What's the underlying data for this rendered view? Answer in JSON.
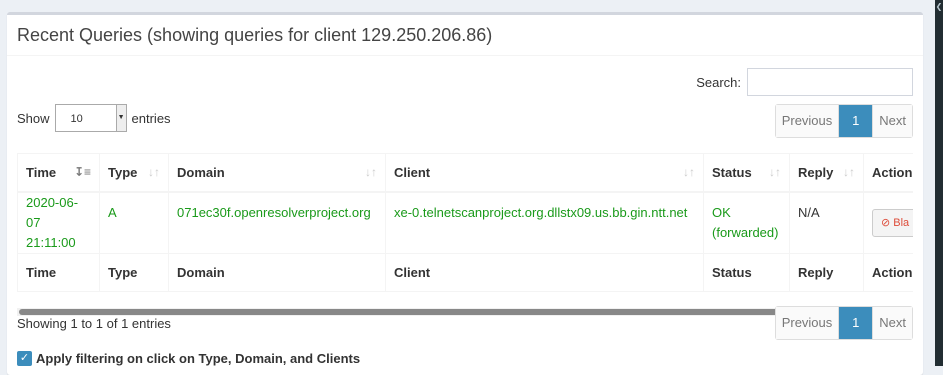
{
  "header": {
    "title": "Recent Queries (showing queries for client 129.250.206.86)"
  },
  "search": {
    "label": "Search:",
    "value": ""
  },
  "length": {
    "show_label": "Show",
    "value": "10",
    "entries_label": "entries"
  },
  "pagination": {
    "previous": "Previous",
    "current_page": "1",
    "next": "Next"
  },
  "table": {
    "columns": [
      "Time",
      "Type",
      "Domain",
      "Client",
      "Status",
      "Reply",
      "Action"
    ],
    "rows": [
      {
        "time_date": "2020-06-07",
        "time_clock": "21:11:00",
        "type": "A",
        "domain": "071ec30f.openresolverproject.org",
        "client": "xe-0.telnetscanproject.org.dllstx09.us.bb.gin.ntt.net",
        "status_main": "OK",
        "status_sub": "(forwarded)",
        "reply": "N/A",
        "action_label": "Bla"
      }
    ]
  },
  "info": "Showing 1 to 1 of 1 entries",
  "filter_checkbox": {
    "label": "Apply filtering on click on Type, Domain, and Clients",
    "checked": true
  },
  "colors": {
    "primary": "#3c8dbc",
    "ok_green": "#1a9a1a",
    "danger": "#dd4b39"
  },
  "icons": {
    "sort_desc": "sort-amount-desc-icon",
    "sort": "sort-icon",
    "ban": "ban-icon",
    "check": "check-icon",
    "chevron_left": "chevron-left-icon",
    "select_arrow": "caret-down-icon"
  }
}
